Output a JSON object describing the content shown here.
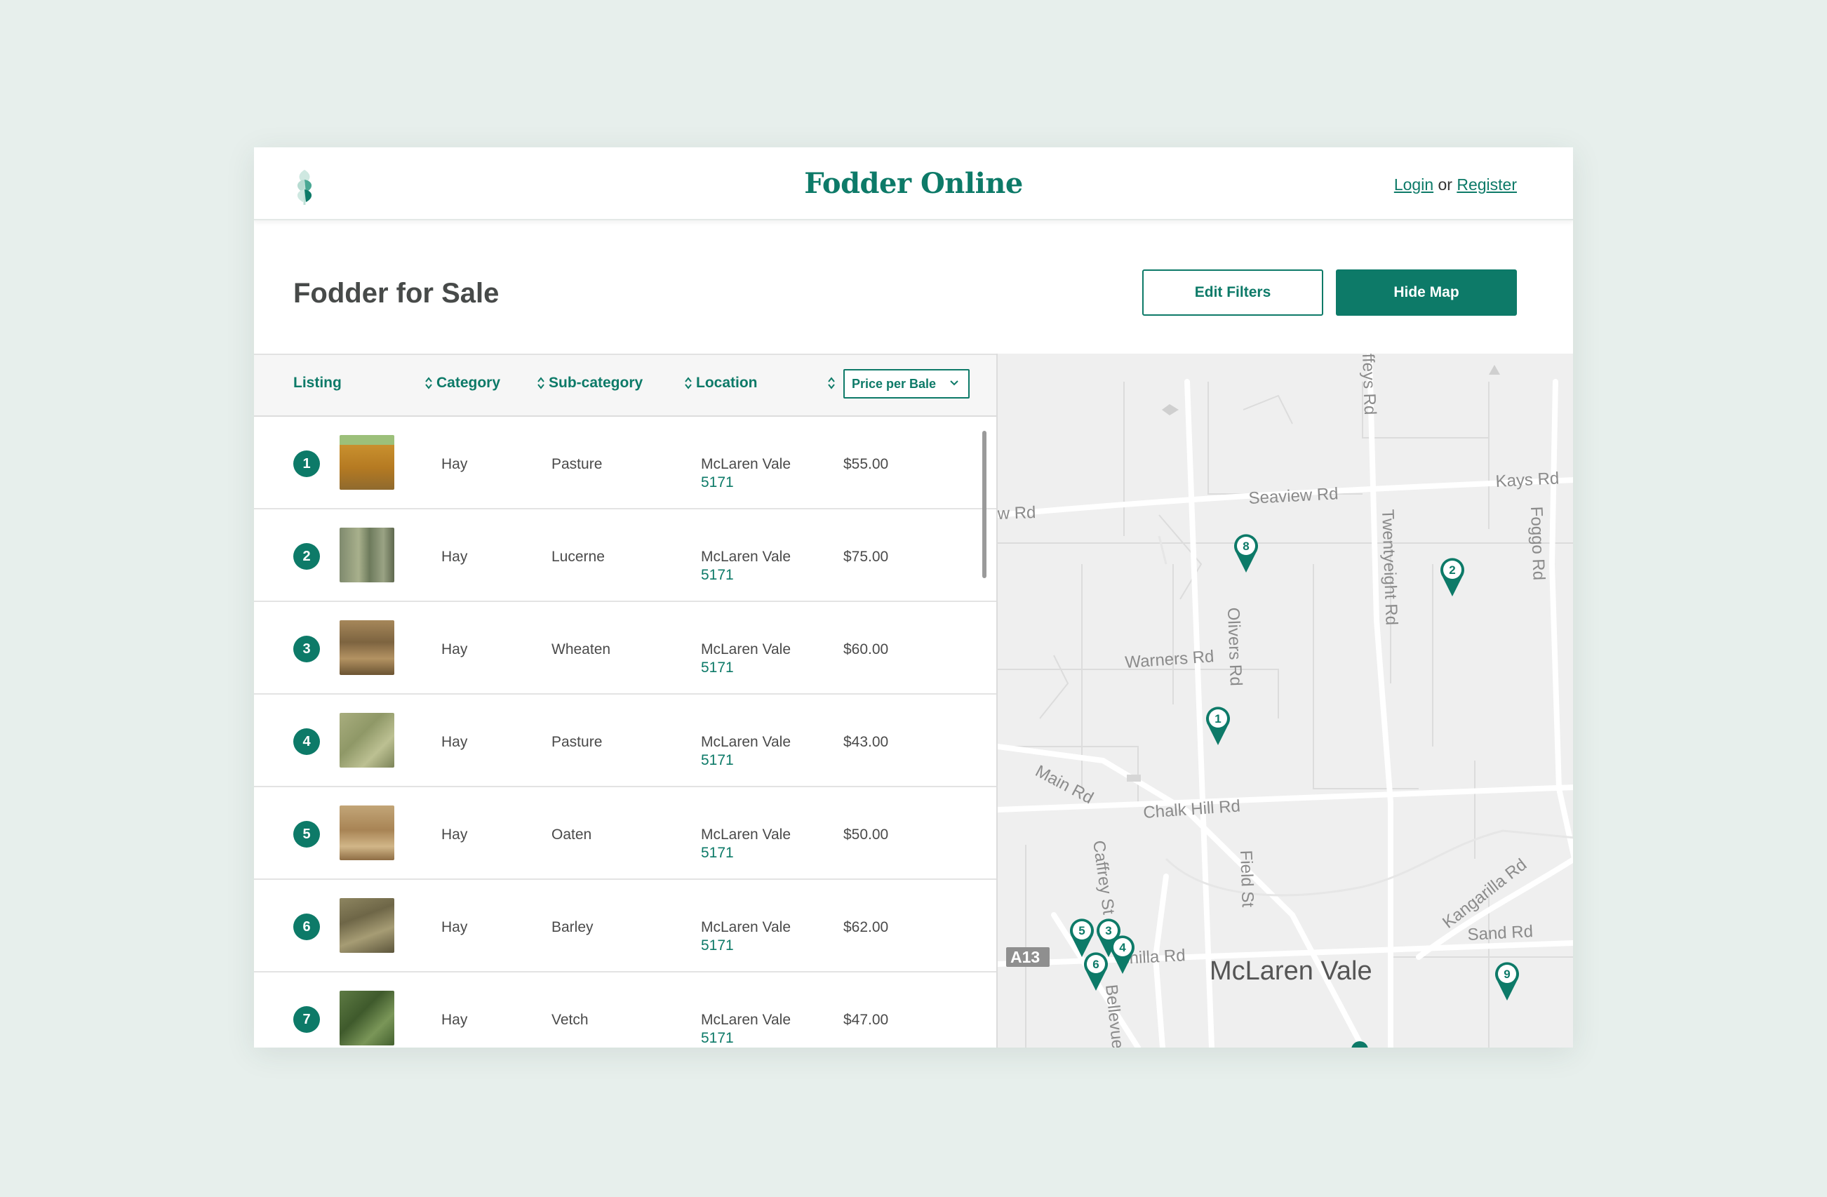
{
  "header": {
    "brand": "Fodder Online",
    "login": "Login",
    "or": "or",
    "register": "Register"
  },
  "page": {
    "title": "Fodder for Sale",
    "edit_filters": "Edit Filters",
    "hide_map": "Hide Map"
  },
  "table": {
    "columns": {
      "listing": "Listing",
      "category": "Category",
      "subcategory": "Sub-category",
      "location": "Location",
      "price": "Price per Bale"
    },
    "rows": [
      {
        "num": "1",
        "category": "Hay",
        "subcategory": "Pasture",
        "location": "McLaren Vale",
        "postcode": "5171",
        "price": "$55.00"
      },
      {
        "num": "2",
        "category": "Hay",
        "subcategory": "Lucerne",
        "location": "McLaren Vale",
        "postcode": "5171",
        "price": "$75.00"
      },
      {
        "num": "3",
        "category": "Hay",
        "subcategory": "Wheaten",
        "location": "McLaren Vale",
        "postcode": "5171",
        "price": "$60.00"
      },
      {
        "num": "4",
        "category": "Hay",
        "subcategory": "Pasture",
        "location": "McLaren Vale",
        "postcode": "5171",
        "price": "$43.00"
      },
      {
        "num": "5",
        "category": "Hay",
        "subcategory": "Oaten",
        "location": "McLaren Vale",
        "postcode": "5171",
        "price": "$50.00"
      },
      {
        "num": "6",
        "category": "Hay",
        "subcategory": "Barley",
        "location": "McLaren Vale",
        "postcode": "5171",
        "price": "$62.00"
      },
      {
        "num": "7",
        "category": "Hay",
        "subcategory": "Vetch",
        "location": "McLaren Vale",
        "postcode": "5171",
        "price": "$47.00"
      }
    ]
  },
  "map": {
    "roads": {
      "seaview": "Seaview Rd",
      "kays": "Kays Rd",
      "w": "w Rd",
      "foggo": "Foggo Rd",
      "twentyeight": "Twentyeight Rd",
      "ffeys": "ffeys Rd",
      "warners": "Warners Rd",
      "olivers": "Olivers Rd",
      "main": "Main Rd",
      "chalk": "Chalk Hill Rd",
      "field": "Field St",
      "caffrey": "Caffrey St",
      "kangarilla": "Kangarilla Rd",
      "sand": "Sand Rd",
      "achilla": "chilla Rd",
      "bellevue": "Bellevue",
      "a13": "A13"
    },
    "town": "McLaren Vale",
    "markers": [
      "8",
      "2",
      "1",
      "5",
      "3",
      "4",
      "6",
      "9"
    ]
  },
  "colors": {
    "accent": "#0d7a68",
    "background": "#e7efec"
  },
  "icons": {
    "logo": "wheat-icon",
    "sort": "sort-icon",
    "dropdown": "chevron-down-icon",
    "marker": "map-pin-icon"
  }
}
